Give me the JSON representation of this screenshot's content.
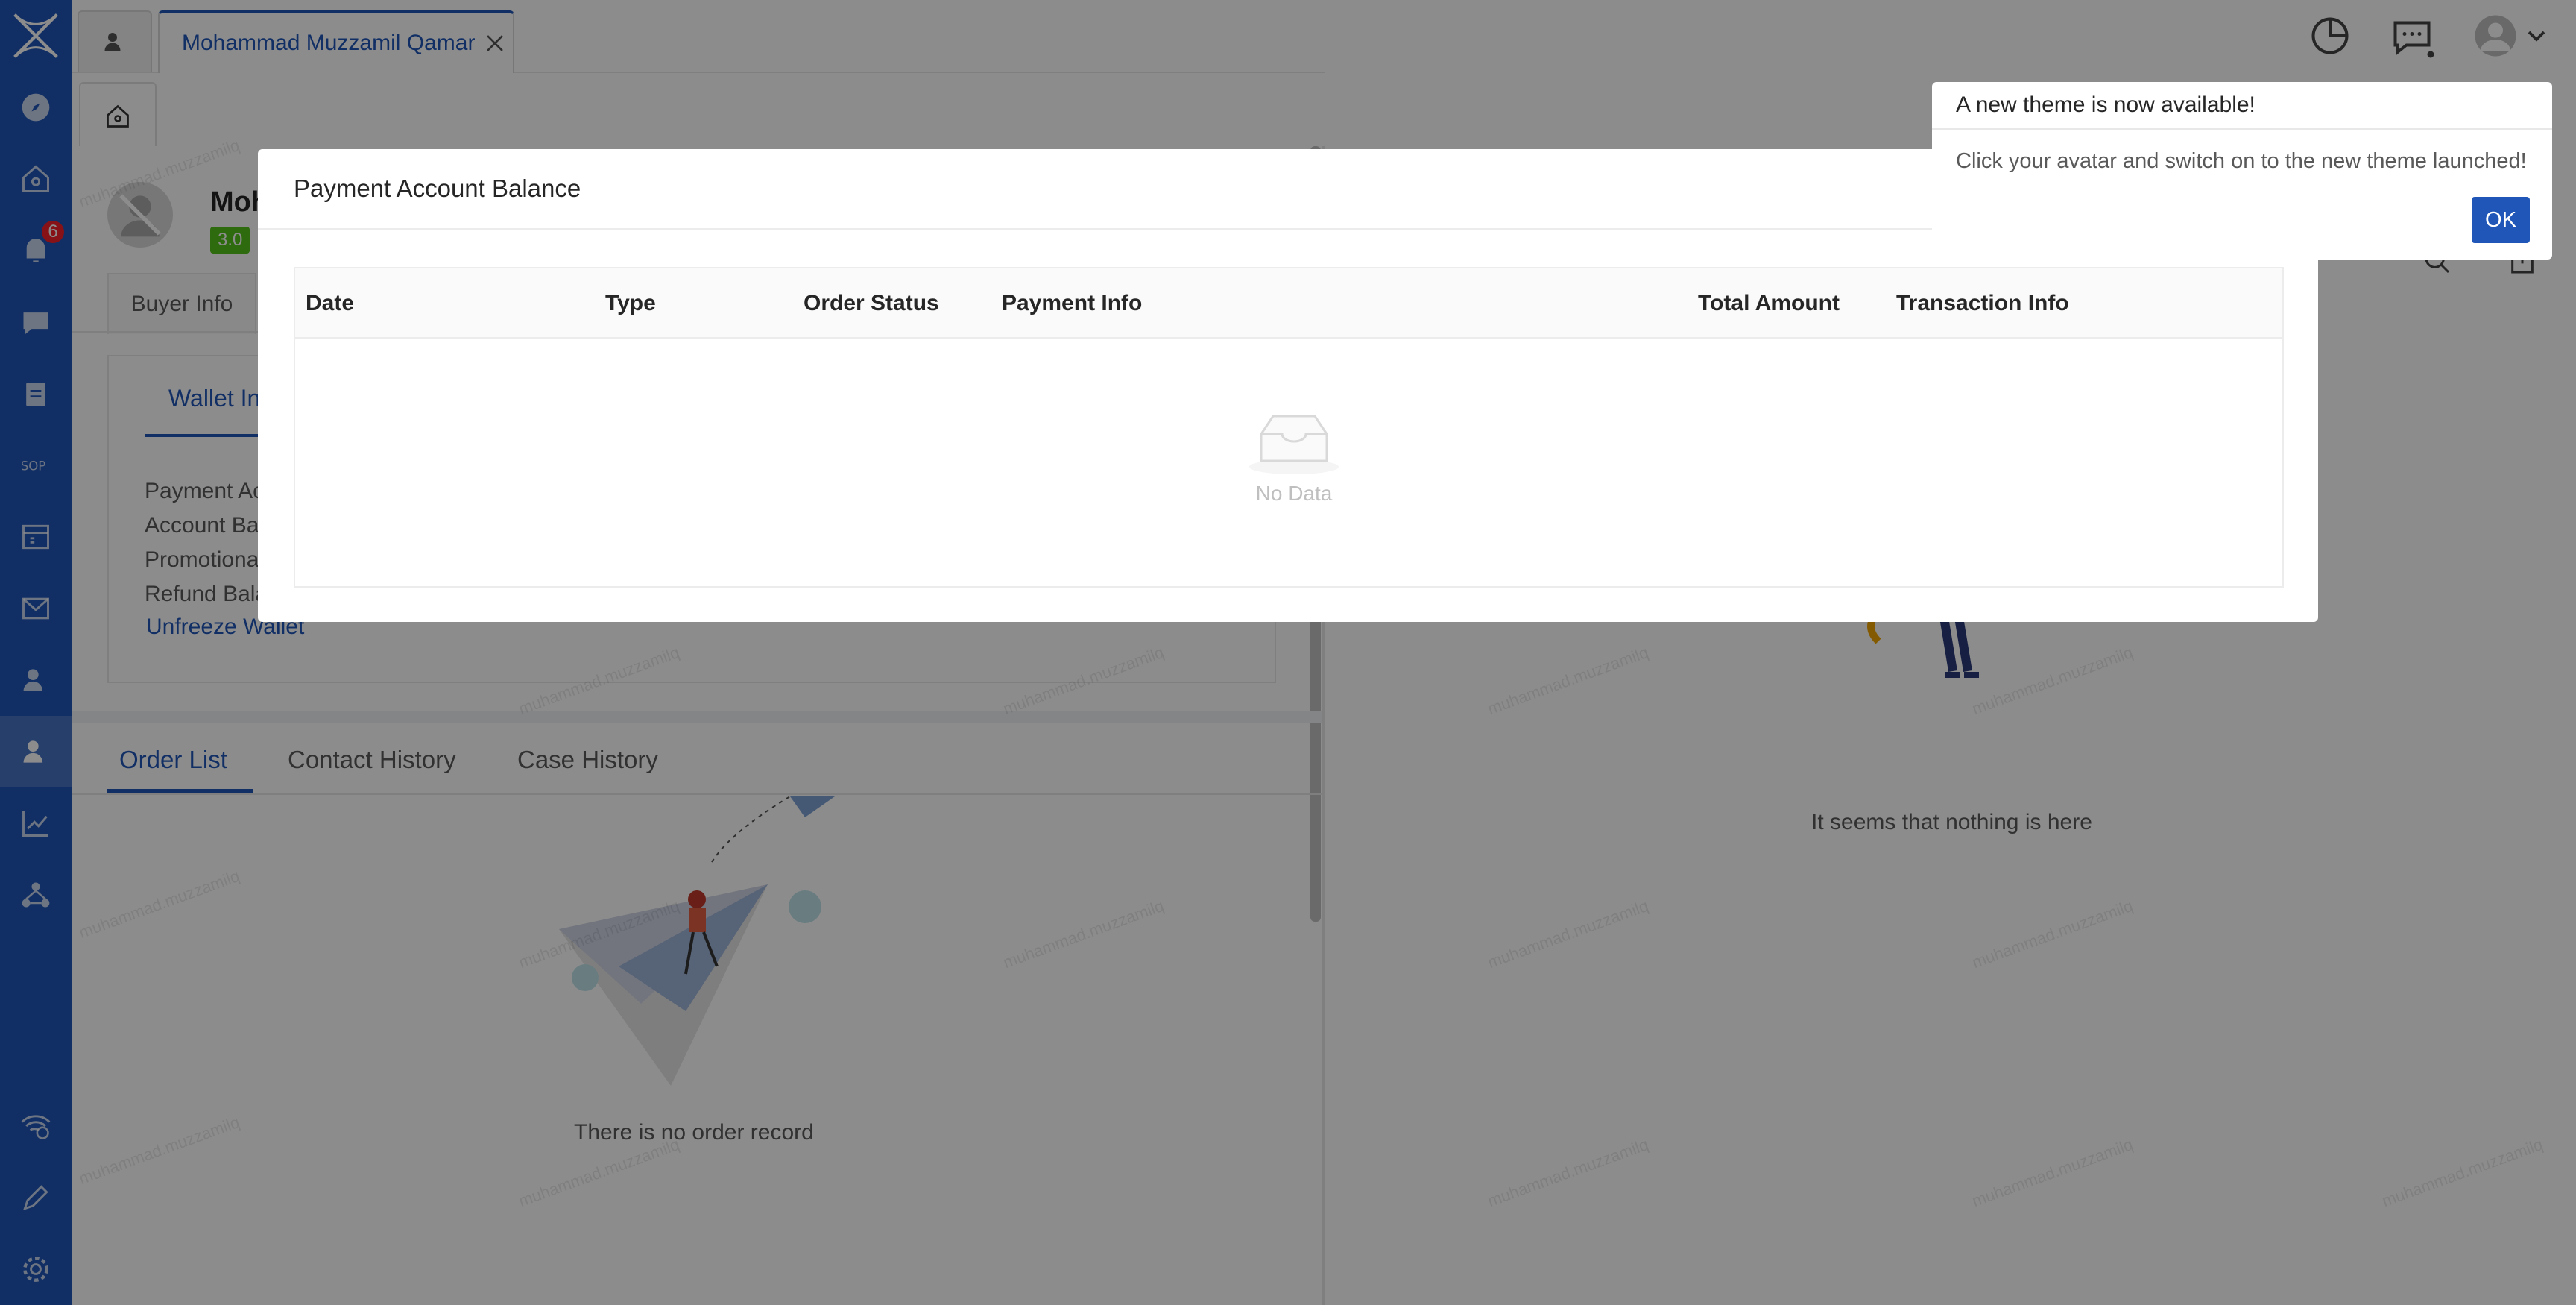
{
  "header": {
    "tab_title": "Mohammad Muzzamil Qamar"
  },
  "sidebar": {
    "notification_count": "6",
    "items": [
      "compass-icon",
      "home-icon",
      "bell-icon",
      "chat-icon",
      "clipboard-icon",
      "sop-icon",
      "calendar-icon",
      "mail-icon",
      "users-icon",
      "buyer-icon",
      "chart-icon",
      "network-icon",
      "wifi-clock-icon",
      "pen-icon",
      "gear-icon"
    ]
  },
  "profile": {
    "name": "Moh",
    "level": "3.0"
  },
  "tabs": {
    "buyer_info": "Buyer Info",
    "wallet_info": "Wallet In"
  },
  "wallet": {
    "rows": [
      "Payment Ac",
      "Account Bal",
      "Promotional",
      "Refund Bala"
    ],
    "unfreeze": "Unfreeze Wallet"
  },
  "bottom_tabs": {
    "order_list": "Order List",
    "contact_history": "Contact History",
    "case_history": "Case History"
  },
  "empty": {
    "order": "There is no order record",
    "right": "It seems that nothing is here"
  },
  "modal": {
    "title": "Payment Account Balance",
    "columns": [
      "Date",
      "Type",
      "Order Status",
      "Payment Info",
      "Total Amount",
      "Transaction Info"
    ],
    "no_data": "No Data"
  },
  "popup": {
    "title": "A new theme is now available!",
    "body": "Click your avatar and switch on to the new theme launched!",
    "ok": "OK"
  },
  "watermark": "muhammad.muzzamilq",
  "colors": {
    "primary": "#1f56b8",
    "badge": "#f5222d",
    "level": "#52c41a"
  }
}
